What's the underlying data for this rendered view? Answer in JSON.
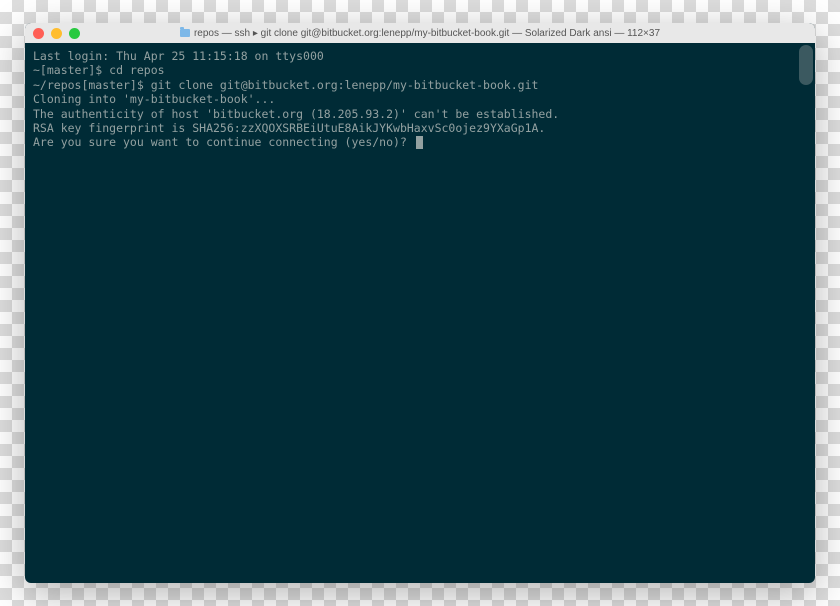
{
  "window": {
    "title": "repos — ssh ▸ git clone git@bitbucket.org:lenepp/my-bitbucket-book.git — Solarized Dark ansi — 112×37"
  },
  "terminal": {
    "lines": [
      "Last login: Thu Apr 25 11:15:18 on ttys000",
      "~[master]$ cd repos",
      "~/repos[master]$ git clone git@bitbucket.org:lenepp/my-bitbucket-book.git",
      "Cloning into 'my-bitbucket-book'...",
      "The authenticity of host 'bitbucket.org (18.205.93.2)' can't be established.",
      "RSA key fingerprint is SHA256:zzXQOXSRBEiUtuE8AikJYKwbHaxvSc0ojez9YXaGp1A.",
      "Are you sure you want to continue connecting (yes/no)? "
    ]
  }
}
